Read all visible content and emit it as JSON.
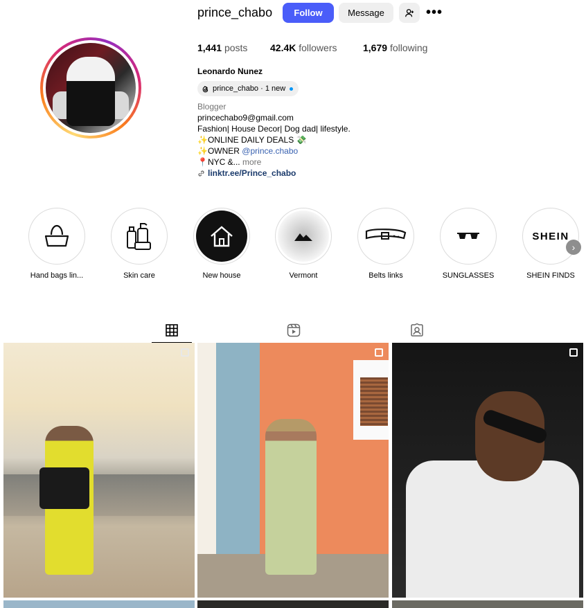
{
  "profile": {
    "username": "prince_chabo",
    "follow_label": "Follow",
    "message_label": "Message",
    "more_label": "•••",
    "stats": {
      "posts_count": "1,441",
      "posts_label": "posts",
      "followers_count": "42.4K",
      "followers_label": "followers",
      "following_count": "1,679",
      "following_label": "following"
    },
    "full_name": "Leonardo Nunez",
    "threads_badge": "prince_chabo · 1 new",
    "bio": {
      "category": "Blogger",
      "email": "princechabo9@gmail.com",
      "line1": "Fashion| House Decor| Dog dad| lifestyle.",
      "line2": "ONLINE DAILY DEALS",
      "line3_prefix": "OWNER ",
      "line3_mention": "@prince.chabo",
      "line4": "NYC &...",
      "more": "more",
      "link": "linktr.ee/Prince_chabo"
    }
  },
  "highlights": [
    {
      "label": "Hand bags lin...",
      "icon": "handbag-icon"
    },
    {
      "label": "Skin care",
      "icon": "skincare-bottles-icon"
    },
    {
      "label": "New house",
      "icon": "house-icon"
    },
    {
      "label": "Vermont",
      "icon": "mountain-icon"
    },
    {
      "label": "Belts links",
      "icon": "belt-icon"
    },
    {
      "label": "SUNGLASSES",
      "icon": "sunglasses-icon"
    },
    {
      "label": "SHEIN FINDS",
      "icon": "shein-logo",
      "logo_text": "SHEIN"
    }
  ],
  "tabs": [
    "posts-grid-icon",
    "reels-icon",
    "tagged-icon"
  ],
  "colors": {
    "follow": "#4a5df9",
    "mention": "#3861b0",
    "threads_dot": "#0095f6"
  }
}
